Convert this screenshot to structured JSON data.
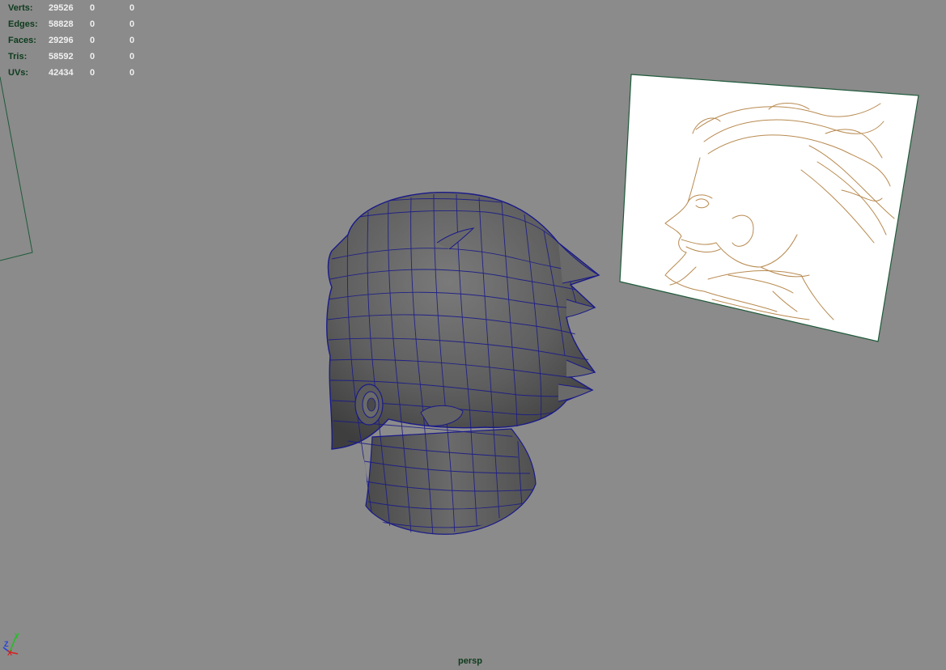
{
  "viewport": {
    "camera_label": "persp"
  },
  "hud": {
    "rows": [
      {
        "label": "Verts:",
        "v1": "29526",
        "v2": "0",
        "v3": "0"
      },
      {
        "label": "Edges:",
        "v1": "58828",
        "v2": "0",
        "v3": "0"
      },
      {
        "label": "Faces:",
        "v1": "29296",
        "v2": "0",
        "v3": "0"
      },
      {
        "label": "Tris:",
        "v1": "58592",
        "v2": "0",
        "v3": "0"
      },
      {
        "label": "UVs:",
        "v1": "42434",
        "v2": "0",
        "v3": "0"
      }
    ]
  },
  "axis": {
    "y_label": "Y",
    "z_label": "Z",
    "x_label": "X",
    "colors": {
      "x": "#d62020",
      "y": "#20c020",
      "z": "#2040e0"
    }
  },
  "colors": {
    "background": "#8b8b8b",
    "wireframe": "#1a1a8a",
    "mesh": "#5c5c5c",
    "sketch": "#b88a50"
  }
}
